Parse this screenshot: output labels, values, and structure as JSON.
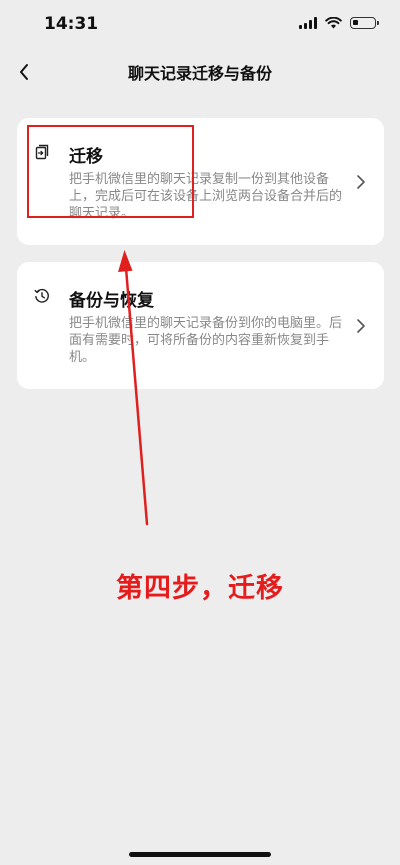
{
  "status_bar": {
    "time": "14:31",
    "battery_level": 0.25
  },
  "nav": {
    "title": "聊天记录迁移与备份",
    "back_icon": "chevron-left-icon"
  },
  "options": [
    {
      "title": "迁移",
      "description": "把手机微信里的聊天记录复制一份到其他设备上，完成后可在该设备上浏览两台设备合并后的聊天记录。",
      "icon": "migrate-icon"
    },
    {
      "title": "备份与恢复",
      "description": "把手机微信里的聊天记录备份到你的电脑里。后面有需要时，可将所备份的内容重新恢复到手机。",
      "icon": "history-icon"
    }
  ],
  "annotation": {
    "label": "第四步，迁移",
    "color": "#e61c1c"
  },
  "colors": {
    "background": "#ededed",
    "card": "#ffffff",
    "description": "#888888",
    "annotation": "#e01f1f"
  }
}
